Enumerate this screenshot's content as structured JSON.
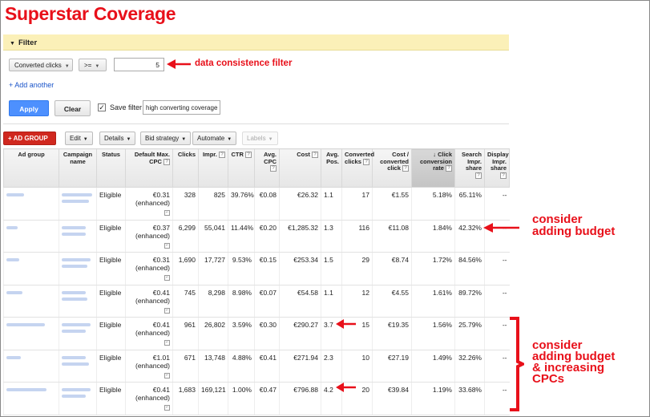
{
  "page_title": "Superstar Coverage",
  "filter": {
    "header": "Filter",
    "metric_dropdown": "Converted clicks",
    "operator_dropdown": ">=",
    "value": "5",
    "add_another": "+ Add another",
    "apply": "Apply",
    "clear": "Clear",
    "save_filter_label": "Save filter",
    "save_filter_checked": true,
    "save_filter_name": "high converting coverage"
  },
  "toolbar": {
    "add_group": "+ AD GROUP",
    "edit": "Edit",
    "details": "Details",
    "bid_strategy": "Bid strategy",
    "automate": "Automate",
    "labels": "Labels"
  },
  "table": {
    "columns": [
      "Ad group",
      "Campaign name",
      "Status",
      "Default Max. CPC",
      "Clicks",
      "Impr.",
      "CTR",
      "Avg. CPC",
      "Cost",
      "Avg. Pos.",
      "Converted clicks",
      "Cost / converted click",
      "Click conversion rate",
      "Search Impr. share",
      "Display Impr. share"
    ],
    "rows": [
      {
        "status": "Eligible",
        "cpc": "€0.31",
        "cpc_note": "(enhanced)",
        "clicks": "328",
        "impr": "825",
        "ctr": "39.76%",
        "avg_cpc": "€0.08",
        "cost": "€26.32",
        "avg_pos": "1.1",
        "conv": "17",
        "cost_conv": "€1.55",
        "conv_rate": "5.18%",
        "search_share": "65.11%",
        "display_share": "--"
      },
      {
        "status": "Eligible",
        "cpc": "€0.37",
        "cpc_note": "(enhanced)",
        "clicks": "6,299",
        "impr": "55,041",
        "ctr": "11.44%",
        "avg_cpc": "€0.20",
        "cost": "€1,285.32",
        "avg_pos": "1.3",
        "conv": "116",
        "cost_conv": "€11.08",
        "conv_rate": "1.84%",
        "search_share": "42.32%",
        "display_share": "--"
      },
      {
        "status": "Eligible",
        "cpc": "€0.31",
        "cpc_note": "(enhanced)",
        "clicks": "1,690",
        "impr": "17,727",
        "ctr": "9.53%",
        "avg_cpc": "€0.15",
        "cost": "€253.34",
        "avg_pos": "1.5",
        "conv": "29",
        "cost_conv": "€8.74",
        "conv_rate": "1.72%",
        "search_share": "84.56%",
        "display_share": "--"
      },
      {
        "status": "Eligible",
        "cpc": "€0.41",
        "cpc_note": "(enhanced)",
        "clicks": "745",
        "impr": "8,298",
        "ctr": "8.98%",
        "avg_cpc": "€0.07",
        "cost": "€54.58",
        "avg_pos": "1.1",
        "conv": "12",
        "cost_conv": "€4.55",
        "conv_rate": "1.61%",
        "search_share": "89.72%",
        "display_share": "--"
      },
      {
        "status": "Eligible",
        "cpc": "€0.41",
        "cpc_note": "(enhanced)",
        "clicks": "961",
        "impr": "26,802",
        "ctr": "3.59%",
        "avg_cpc": "€0.30",
        "cost": "€290.27",
        "avg_pos": "3.7",
        "conv": "15",
        "cost_conv": "€19.35",
        "conv_rate": "1.56%",
        "search_share": "25.79%",
        "display_share": "--"
      },
      {
        "status": "Eligible",
        "cpc": "€1.01",
        "cpc_note": "(enhanced)",
        "clicks": "671",
        "impr": "13,748",
        "ctr": "4.88%",
        "avg_cpc": "€0.41",
        "cost": "€271.94",
        "avg_pos": "2.3",
        "conv": "10",
        "cost_conv": "€27.19",
        "conv_rate": "1.49%",
        "search_share": "32.26%",
        "display_share": "--"
      },
      {
        "status": "Eligible",
        "cpc": "€0.41",
        "cpc_note": "(enhanced)",
        "clicks": "1,683",
        "impr": "169,121",
        "ctr": "1.00%",
        "avg_cpc": "€0.47",
        "cost": "€796.88",
        "avg_pos": "4.2",
        "conv": "20",
        "cost_conv": "€39.84",
        "conv_rate": "1.19%",
        "search_share": "33.68%",
        "display_share": "--"
      }
    ]
  },
  "annotations": {
    "filter_note": "data consistence filter",
    "budget_note_line1": "consider",
    "budget_note_line2": "adding budget",
    "budget_cpc_line1": "consider",
    "budget_cpc_line2": "adding budget",
    "budget_cpc_line3": "& increasing",
    "budget_cpc_line4": "CPCs"
  },
  "colors": {
    "accent_red": "#e8101a",
    "filter_bg": "#fbf0b8",
    "apply_blue": "#4d90fe",
    "add_group_red": "#d0281f"
  }
}
